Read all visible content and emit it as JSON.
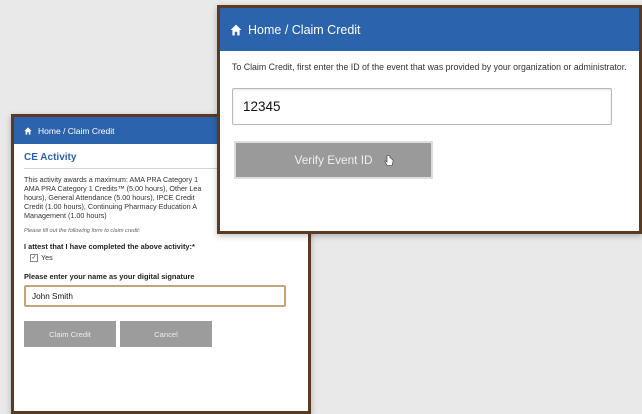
{
  "back_panel": {
    "breadcrumb": "Home / Claim Credit",
    "section_title": "CE Activity",
    "body": "This activity awards a maximum: AMA PRA Category 1\nAMA PRA Category 1 Credits™ (5.00 hours), Other Lea\nhours), General Attendance (5.00 hours), IPCE Credit\nCredit (1.00 hours), Continuing Pharmacy Education A\nManagement (1.00 hours)",
    "instruction": "Please fill out the following form to claim credit:",
    "attest_label": "I attest that I have completed the above activity:*",
    "check_mark": "✓",
    "yes_label": "Yes",
    "signature_label": "Please enter your name as your digital signature",
    "signature_value": "John Smith",
    "claim_button": "Claim Credit",
    "cancel_button": "Cancel"
  },
  "front_panel": {
    "breadcrumb": "Home / Claim Credit",
    "intro": "To Claim Credit, first enter the ID of the event that was provided by your organization or administrator.",
    "event_id_value": "12345",
    "verify_button": "Verify Event ID"
  },
  "icons": [
    "home-icon",
    "pointer-cursor-icon",
    "checkbox-icon"
  ],
  "colors": {
    "header_blue": "#2c63ad",
    "frame_brown": "#5b3a23",
    "button_gray": "#9a9a9a",
    "signature_border": "#c4a27a",
    "background": "#eae9e9"
  }
}
